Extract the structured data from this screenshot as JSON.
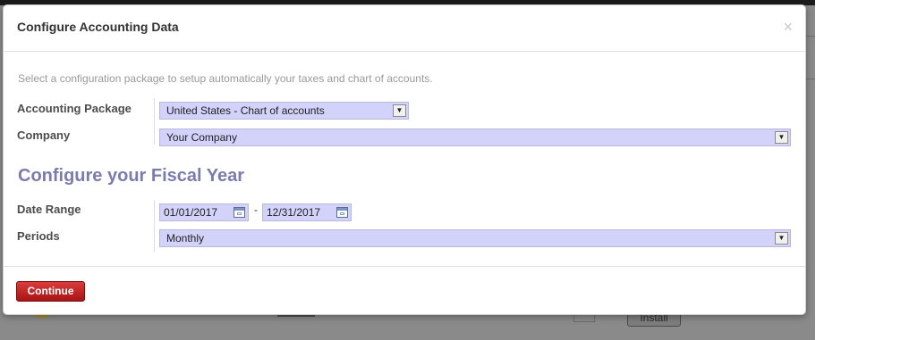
{
  "dialog": {
    "title": "Configure Accounting Data",
    "close_label": "×",
    "intro": "Select a configuration package to setup automatically your taxes and chart of accounts."
  },
  "form": {
    "accounting_package": {
      "label": "Accounting Package",
      "value": "United States - Chart of accounts"
    },
    "company": {
      "label": "Company",
      "value": "Your Company"
    }
  },
  "fiscal_year": {
    "title": "Configure your Fiscal Year",
    "date_range": {
      "label": "Date Range",
      "start": "01/01/2017",
      "separator": "-",
      "end": "12/31/2017"
    },
    "periods": {
      "label": "Periods",
      "value": "Monthly"
    }
  },
  "footer": {
    "continue_label": "Continue"
  },
  "background": {
    "install_label": "Install"
  },
  "colors": {
    "field_bg": "#d2d2fb",
    "section_title": "#7c7bad",
    "primary_button": "#c22424"
  }
}
